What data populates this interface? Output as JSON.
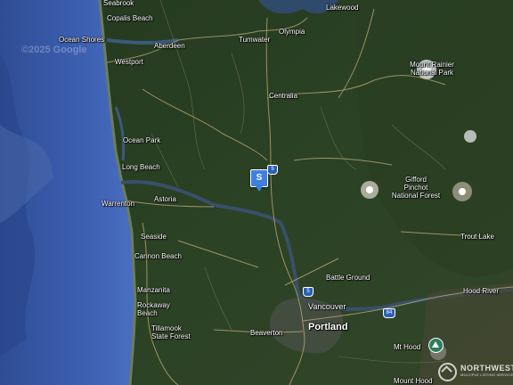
{
  "map": {
    "type": "satellite",
    "watermark": "©2025 Google",
    "marker_label": "S",
    "labels": {
      "seabrook": "Seabrook",
      "copalis": "Copalis Beach",
      "ocean_shores": "Ocean Shores",
      "aberdeen": "Aberdeen",
      "westport": "Westport",
      "tumwater": "Tumwater",
      "olympia": "Olympia",
      "lakewood": "Lakewood",
      "rainier_1": "Mount Rainier",
      "rainier_2": "National Park",
      "centralia": "Centralia",
      "ocean_park": "Ocean Park",
      "long_beach": "Long Beach",
      "gifford_1": "Gifford",
      "gifford_2": "Pinchot",
      "gifford_3": "National Forest",
      "warrenton": "Warrenton",
      "astoria": "Astoria",
      "seaside": "Seaside",
      "cannon": "Cannon Beach",
      "trout_lake": "Trout Lake",
      "battle_ground": "Battle Ground",
      "hood_river": "Hood River",
      "manzanita": "Manzanita",
      "rockaway_1": "Rockaway",
      "rockaway_2": "Beach",
      "vancouver": "Vancouver",
      "tillamook_1": "Tillamook",
      "tillamook_2": "State Forest",
      "beaverton": "Beaverton",
      "portland": "Portland",
      "mt_hood": "Mt Hood",
      "mount_hood": "Mount Hood"
    },
    "shields": {
      "i5_north": "5",
      "i5_south": "5",
      "i84": "84"
    },
    "logo": {
      "name": "NORTHWEST",
      "tagline": "MULTIPLE LISTING SERVICE"
    }
  }
}
